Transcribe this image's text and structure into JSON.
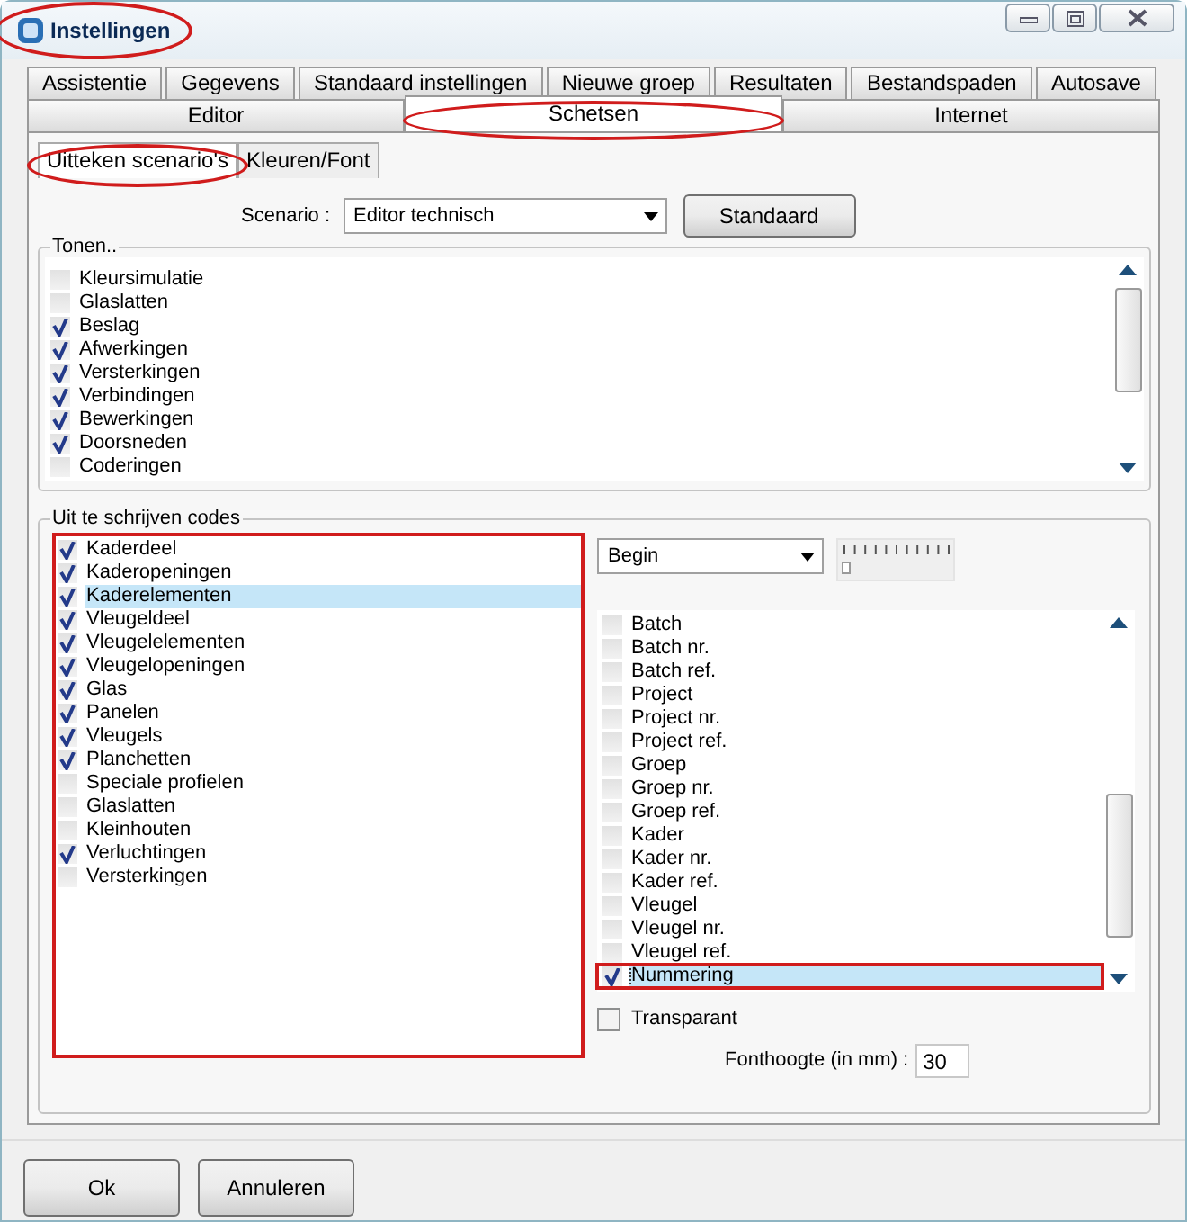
{
  "window": {
    "title": "Instellingen",
    "annotated": true
  },
  "tabs_row_1": [
    {
      "label": "Assistentie",
      "selected": false
    },
    {
      "label": "Gegevens",
      "selected": false
    },
    {
      "label": "Standaard instellingen",
      "selected": false
    },
    {
      "label": "Nieuwe groep",
      "selected": false
    },
    {
      "label": "Resultaten",
      "selected": false
    },
    {
      "label": "Bestandspaden",
      "selected": false
    },
    {
      "label": "Autosave",
      "selected": false
    }
  ],
  "tabs_row_2": [
    {
      "label": "Editor",
      "selected": false,
      "annotated": false
    },
    {
      "label": "Schetsen",
      "selected": true,
      "annotated": true
    },
    {
      "label": "Internet",
      "selected": false,
      "annotated": false
    }
  ],
  "subtabs": [
    {
      "label": "Uitteken scenario's",
      "selected": true,
      "annotated": true
    },
    {
      "label": "Kleuren/Font",
      "selected": false,
      "annotated": false
    }
  ],
  "scenario": {
    "label": "Scenario :",
    "value": "Editor technisch",
    "button": "Standaard"
  },
  "tonen": {
    "title": "Tonen..",
    "items": [
      {
        "label": "Kleursimulatie",
        "checked": false
      },
      {
        "label": "Glaslatten",
        "checked": false
      },
      {
        "label": "Beslag",
        "checked": true
      },
      {
        "label": "Afwerkingen",
        "checked": true
      },
      {
        "label": "Versterkingen",
        "checked": true
      },
      {
        "label": "Verbindingen",
        "checked": true
      },
      {
        "label": "Bewerkingen",
        "checked": true
      },
      {
        "label": "Doorsneden",
        "checked": true
      },
      {
        "label": "Coderingen",
        "checked": false
      }
    ]
  },
  "codes": {
    "title": "Uit te schrijven codes",
    "list_annotated": true,
    "items": [
      {
        "label": "Kaderdeel",
        "checked": true,
        "selected": false
      },
      {
        "label": "Kaderopeningen",
        "checked": true,
        "selected": false
      },
      {
        "label": "Kaderelementen",
        "checked": true,
        "selected": true
      },
      {
        "label": "Vleugeldeel",
        "checked": true,
        "selected": false
      },
      {
        "label": "Vleugelelementen",
        "checked": true,
        "selected": false
      },
      {
        "label": "Vleugelopeningen",
        "checked": true,
        "selected": false
      },
      {
        "label": "Glas",
        "checked": true,
        "selected": false
      },
      {
        "label": "Panelen",
        "checked": true,
        "selected": false
      },
      {
        "label": "Vleugels",
        "checked": true,
        "selected": false
      },
      {
        "label": "Planchetten",
        "checked": true,
        "selected": false
      },
      {
        "label": "Speciale profielen",
        "checked": false,
        "selected": false
      },
      {
        "label": "Glaslatten",
        "checked": false,
        "selected": false
      },
      {
        "label": "Kleinhouten",
        "checked": false,
        "selected": false
      },
      {
        "label": "Verluchtingen",
        "checked": true,
        "selected": false
      },
      {
        "label": "Versterkingen",
        "checked": false,
        "selected": false
      }
    ],
    "position": {
      "value": "Begin"
    },
    "slider": {
      "level": 0
    },
    "fields": [
      {
        "label": "Batch",
        "checked": false,
        "selected": false,
        "annotated": false
      },
      {
        "label": "Batch nr.",
        "checked": false,
        "selected": false,
        "annotated": false
      },
      {
        "label": "Batch ref.",
        "checked": false,
        "selected": false,
        "annotated": false
      },
      {
        "label": "Project",
        "checked": false,
        "selected": false,
        "annotated": false
      },
      {
        "label": "Project nr.",
        "checked": false,
        "selected": false,
        "annotated": false
      },
      {
        "label": "Project ref.",
        "checked": false,
        "selected": false,
        "annotated": false
      },
      {
        "label": "Groep",
        "checked": false,
        "selected": false,
        "annotated": false
      },
      {
        "label": "Groep nr.",
        "checked": false,
        "selected": false,
        "annotated": false
      },
      {
        "label": "Groep ref.",
        "checked": false,
        "selected": false,
        "annotated": false
      },
      {
        "label": "Kader",
        "checked": false,
        "selected": false,
        "annotated": false
      },
      {
        "label": "Kader nr.",
        "checked": false,
        "selected": false,
        "annotated": false
      },
      {
        "label": "Kader ref.",
        "checked": false,
        "selected": false,
        "annotated": false
      },
      {
        "label": "Vleugel",
        "checked": false,
        "selected": false,
        "annotated": false
      },
      {
        "label": "Vleugel nr.",
        "checked": false,
        "selected": false,
        "annotated": false
      },
      {
        "label": "Vleugel ref.",
        "checked": false,
        "selected": false,
        "annotated": false
      },
      {
        "label": "Nummering",
        "checked": true,
        "selected": true,
        "annotated": true
      }
    ],
    "transparant": {
      "label": "Transparant",
      "checked": false
    },
    "font_height": {
      "label": "Fonthoogte (in mm) :",
      "value": "30"
    }
  },
  "buttons": [
    "Ok",
    "Annuleren"
  ]
}
